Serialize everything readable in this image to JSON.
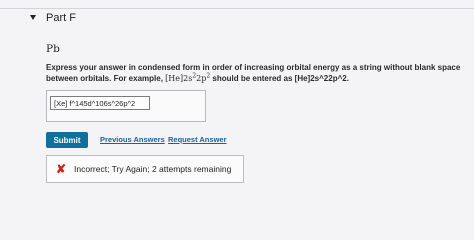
{
  "part": {
    "title": "Part F"
  },
  "question": {
    "element": "Pb",
    "instructions_line1": "Express your answer in condensed form in order of increasing orbital energy as a string without blank space",
    "instructions_line2_prefix": "between orbitals. For example,",
    "example_core": "[He]",
    "example_orb1": "2s",
    "example_sup1": "2",
    "example_orb2": "2p",
    "example_sup2": "2",
    "instructions_line2_suffix": "should be entered as [He]2s^22p^2."
  },
  "answer": {
    "value": "[Xe] f^145d^106s^26p^2"
  },
  "actions": {
    "submit_label": "Submit",
    "previous_answers_label": "Previous Answers",
    "request_answer_label": "Request Answer"
  },
  "feedback": {
    "status": "incorrect",
    "icon": "x-icon",
    "message": "Incorrect; Try Again; 2 attempts remaining"
  },
  "colors": {
    "background": "#f4f4f6",
    "submit_button": "#0f6f9d",
    "link": "#1b5fa6",
    "error_icon": "#c8251f"
  }
}
